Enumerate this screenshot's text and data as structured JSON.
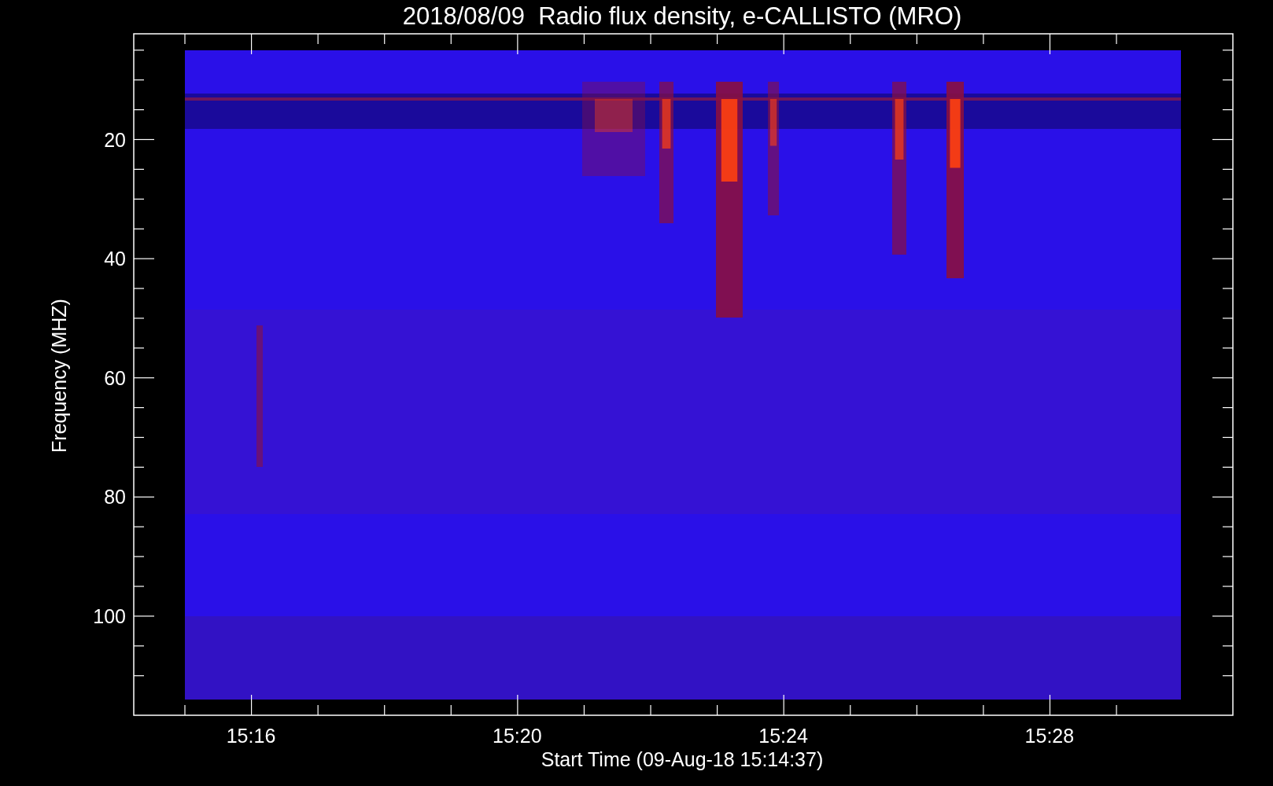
{
  "title": "2018/08/09  Radio flux density, e-CALLISTO (MRO)",
  "y_axis": {
    "label": "Frequency (MHZ)",
    "ticks": [
      "20",
      "40",
      "60",
      "80",
      "100"
    ]
  },
  "x_axis": {
    "label": "Start Time (09-Aug-18 15:14:37)",
    "ticks": [
      "15:16",
      "15:20",
      "15:24",
      "15:28"
    ]
  }
}
